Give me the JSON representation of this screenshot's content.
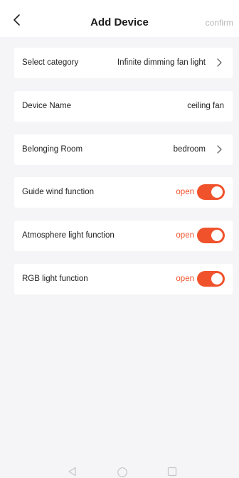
{
  "header": {
    "title": "Add Device",
    "confirm_label": "confirm",
    "back_icon": "chevron-left-icon"
  },
  "rows": [
    {
      "label": "Select category",
      "value": "Infinite dimming fan light",
      "chevron": true
    },
    {
      "label": "Device Name",
      "value": "ceiling fan",
      "chevron": false
    },
    {
      "label": "Belonging Room",
      "value": "bedroom",
      "chevron": true
    },
    {
      "label": "Guide wind function",
      "state": "open",
      "toggle_on": true
    },
    {
      "label": "Atmosphere light function",
      "state": "open",
      "toggle_on": true
    },
    {
      "label": "RGB light function",
      "state": "open",
      "toggle_on": true
    }
  ],
  "colors": {
    "accent": "#f0522c",
    "background": "#f5f5f7",
    "card": "#ffffff",
    "confirm_disabled": "#b9b9bd"
  },
  "navbar": {
    "icons": [
      "nav-back-triangle-icon",
      "nav-home-circle-icon",
      "nav-recents-square-icon"
    ]
  }
}
